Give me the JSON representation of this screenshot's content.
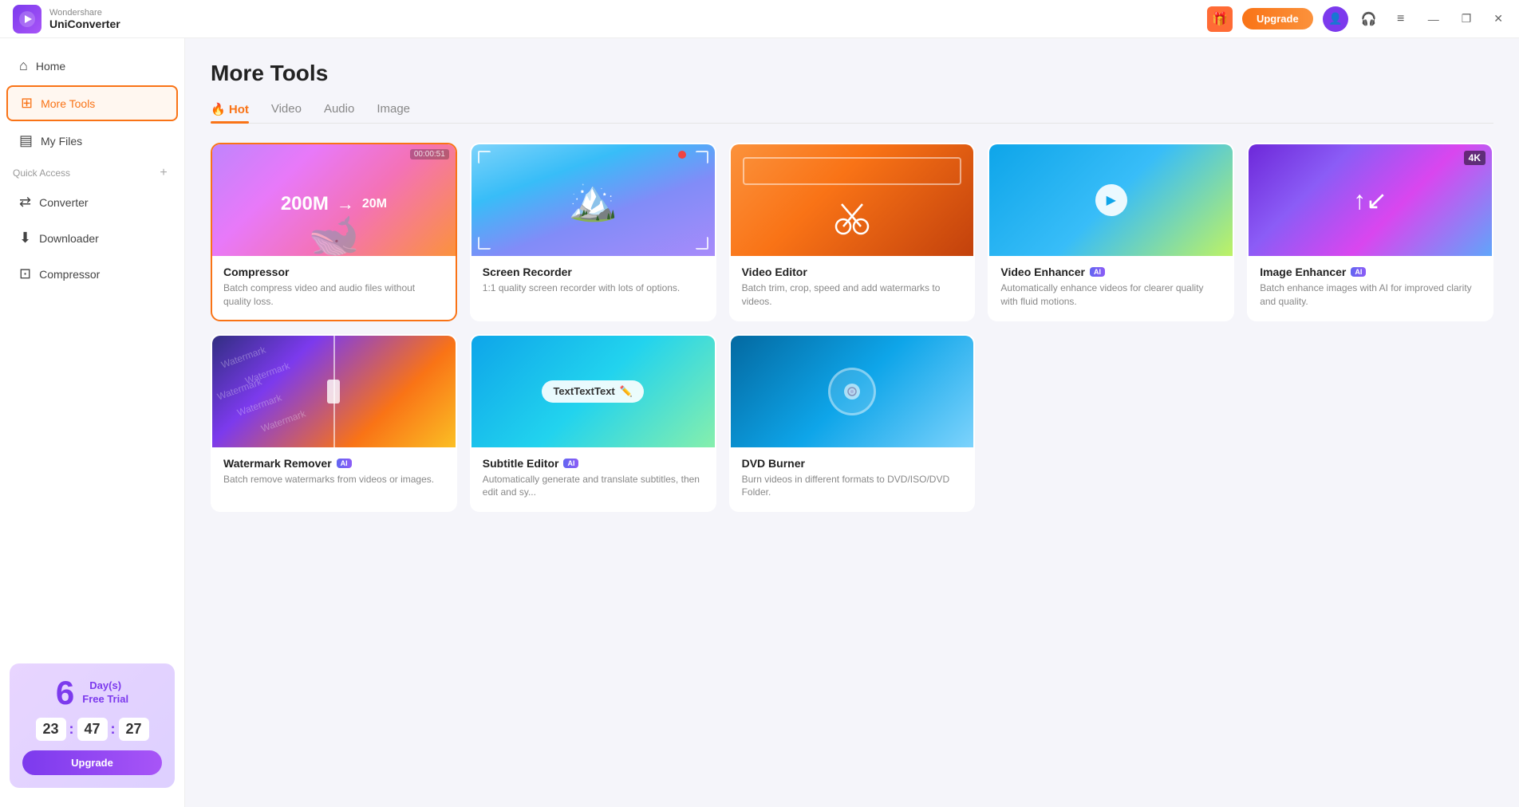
{
  "app": {
    "logo_symbol": "▶",
    "company": "Wondershare",
    "name": "UniConverter"
  },
  "titlebar": {
    "gift_icon": "🎁",
    "upgrade_label": "Upgrade",
    "headset_icon": "🎧",
    "menu_icon": "≡",
    "minimize_icon": "—",
    "restore_icon": "❐",
    "close_icon": "✕"
  },
  "sidebar": {
    "nav_items": [
      {
        "id": "home",
        "label": "Home",
        "icon": "⌂"
      },
      {
        "id": "more-tools",
        "label": "More Tools",
        "icon": "⊞"
      },
      {
        "id": "my-files",
        "label": "My Files",
        "icon": "▤"
      }
    ],
    "quick_access_label": "Quick Access",
    "quick_access_plus": "+",
    "sub_items": [
      {
        "id": "converter",
        "label": "Converter",
        "icon": "⇄"
      },
      {
        "id": "downloader",
        "label": "Downloader",
        "icon": "⬇"
      },
      {
        "id": "compressor",
        "label": "Compressor",
        "icon": "⊡"
      }
    ]
  },
  "trial": {
    "days_number": "6",
    "days_label": "Day(s)",
    "free_trial_label": "Free Trial",
    "countdown": {
      "hours": "23",
      "minutes": "47",
      "seconds": "27"
    },
    "upgrade_label": "Upgrade"
  },
  "main": {
    "title": "More Tools",
    "tabs": [
      {
        "id": "hot",
        "label": "Hot",
        "icon": "🔥",
        "active": true
      },
      {
        "id": "video",
        "label": "Video",
        "active": false
      },
      {
        "id": "audio",
        "label": "Audio",
        "active": false
      },
      {
        "id": "image",
        "label": "Image",
        "active": false
      }
    ],
    "tools": [
      {
        "id": "compressor",
        "name": "Compressor",
        "desc": "Batch compress video and audio files without quality loss.",
        "thumb_type": "compressor",
        "active": true,
        "ai": false,
        "time_label": "00:00:51",
        "size_from": "200M",
        "size_to": "20M"
      },
      {
        "id": "screen-recorder",
        "name": "Screen Recorder",
        "desc": "1:1 quality screen recorder with lots of options.",
        "thumb_type": "recorder",
        "active": false,
        "ai": false
      },
      {
        "id": "video-editor",
        "name": "Video Editor",
        "desc": "Batch trim, crop, speed and add watermarks to videos.",
        "thumb_type": "editor",
        "active": false,
        "ai": false
      },
      {
        "id": "video-enhancer",
        "name": "Video Enhancer",
        "desc": "Automatically enhance videos for clearer quality with fluid motions.",
        "thumb_type": "enhancer",
        "active": false,
        "ai": true
      },
      {
        "id": "image-enhancer",
        "name": "Image Enhancer",
        "desc": "Batch enhance images with AI for improved clarity and quality.",
        "thumb_type": "img-enhancer",
        "active": false,
        "ai": true
      },
      {
        "id": "watermark-remover",
        "name": "Watermark Remover",
        "desc": "Batch remove watermarks from videos or images.",
        "thumb_type": "watermark",
        "active": false,
        "ai": true
      },
      {
        "id": "subtitle-editor",
        "name": "Subtitle Editor",
        "desc": "Automatically generate and translate subtitles, then edit and sy...",
        "thumb_type": "subtitle",
        "active": false,
        "ai": true
      },
      {
        "id": "dvd-burner",
        "name": "DVD Burner",
        "desc": "Burn videos in different formats to DVD/ISO/DVD Folder.",
        "thumb_type": "dvd",
        "active": false,
        "ai": false
      }
    ],
    "ai_badge_label": "AI"
  }
}
